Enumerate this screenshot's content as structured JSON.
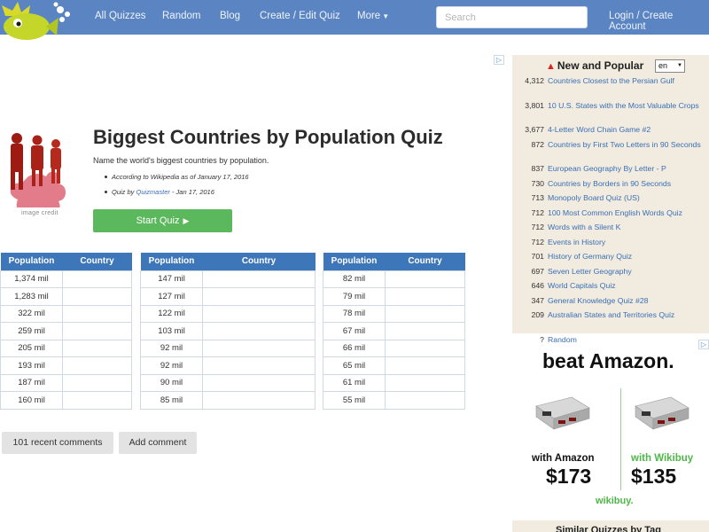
{
  "nav": {
    "links": [
      "All Quizzes",
      "Random",
      "Blog",
      "Create / Edit Quiz",
      "More",
      "Login / Create Account"
    ],
    "search_placeholder": "Search"
  },
  "ad_marker": "▷",
  "quiz": {
    "image_credit": "image credit",
    "title": "Biggest Countries by Population Quiz",
    "description": "Name the world's biggest countries by population.",
    "meta_source": "According to Wikipedia as of January 17, 2016",
    "meta_by_prefix": "Quiz by ",
    "meta_author": "Quizmaster",
    "meta_date": " - Jan 17, 2016",
    "start_label": "Start Quiz",
    "start_icon": "▶"
  },
  "table": {
    "col_population": "Population",
    "col_country": "Country",
    "columns": [
      [
        "1,374 mil",
        "1,283 mil",
        "322 mil",
        "259 mil",
        "205 mil",
        "193 mil",
        "187 mil",
        "160 mil"
      ],
      [
        "147 mil",
        "127 mil",
        "122 mil",
        "103 mil",
        "92 mil",
        "92 mil",
        "90 mil",
        "85 mil"
      ],
      [
        "82 mil",
        "79 mil",
        "78 mil",
        "67 mil",
        "66 mil",
        "65 mil",
        "61 mil",
        "55 mil"
      ]
    ]
  },
  "comments": {
    "recent_label": "101 recent comments",
    "add_label": "Add comment"
  },
  "new_popular": {
    "title": "New and Popular",
    "lang": "en",
    "items": [
      {
        "num": "4,312",
        "title": "Countries Closest to the Persian Gulf"
      },
      {
        "num": "3,801",
        "title": "10 U.S. States with the Most Valuable Crops"
      },
      {
        "num": "3,677",
        "title": "4-Letter Word Chain Game #2"
      },
      {
        "num": "872",
        "title": "Countries by First Two Letters in 90 Seconds"
      },
      {
        "num": "837",
        "title": "European Geography By Letter - P"
      },
      {
        "num": "730",
        "title": "Countries by Borders in 90 Seconds"
      },
      {
        "num": "713",
        "title": "Monopoly Board Quiz (US)"
      },
      {
        "num": "712",
        "title": "100 Most Common English Words Quiz"
      },
      {
        "num": "712",
        "title": "Words with a Silent K"
      },
      {
        "num": "712",
        "title": "Events in History"
      },
      {
        "num": "701",
        "title": "History of Germany Quiz"
      },
      {
        "num": "697",
        "title": "Seven Letter Geography"
      },
      {
        "num": "646",
        "title": "World Capitals Quiz"
      },
      {
        "num": "347",
        "title": "General Knowledge Quiz #28"
      },
      {
        "num": "209",
        "title": "Australian States and Territories Quiz"
      },
      {
        "num": "?",
        "title": "Random"
      }
    ]
  },
  "ad": {
    "headline": "beat Amazon.",
    "left_label": "with Amazon",
    "right_label": "with Wikibuy",
    "left_price": "$173",
    "right_price": "$135",
    "brand": "wikibuy."
  },
  "similar": {
    "title": "Similar Quizzes by Tag"
  },
  "colors": {
    "navbar": "#5b85c2",
    "table_header": "#3d76b9",
    "start_button": "#5cb85c",
    "sidebar_bg": "#f1ebe0",
    "link": "#3a6fb5",
    "wikibuy_green": "#4db848"
  }
}
